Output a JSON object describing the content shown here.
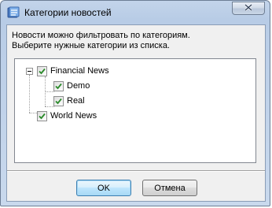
{
  "window": {
    "title": "Категории новостей"
  },
  "description": {
    "line1": "Новости можно фильтровать по категориям.",
    "line2": "Выберите нужные категории из списка."
  },
  "tree": {
    "nodes": [
      {
        "label": "Financial News",
        "checked": true,
        "expanded": true
      },
      {
        "label": "Demo",
        "checked": true
      },
      {
        "label": "Real",
        "checked": true
      },
      {
        "label": "World News",
        "checked": true
      }
    ]
  },
  "buttons": {
    "ok": "OK",
    "cancel": "Отмена"
  },
  "colors": {
    "checkmark": "#2a8a2a",
    "title_frame": "#b8cce6",
    "default_button": "#3c7fb1"
  },
  "icons": {
    "app": "news-categories-icon",
    "close": "close-icon",
    "check": "checkmark-icon"
  }
}
